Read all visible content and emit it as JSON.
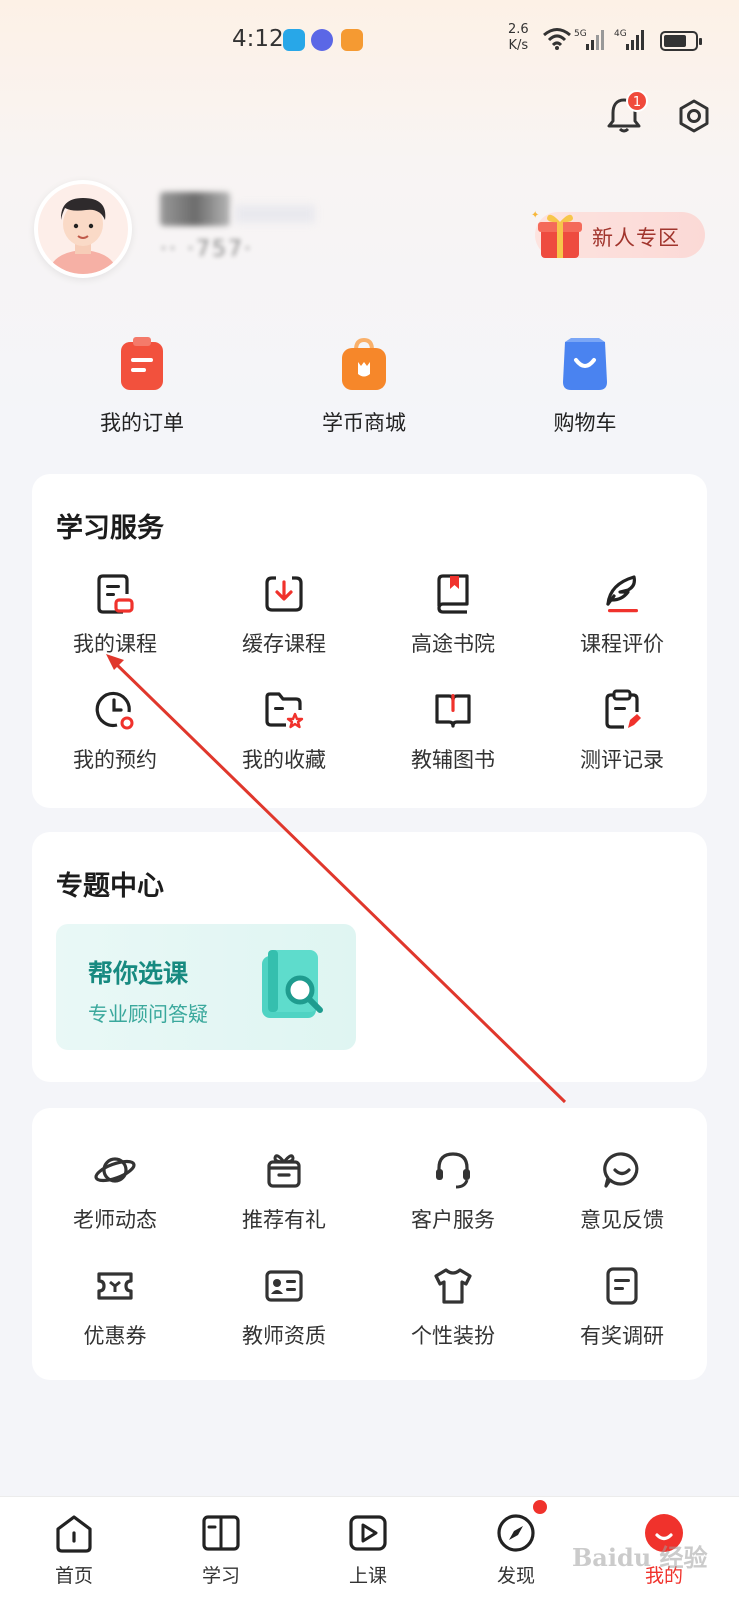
{
  "status_bar": {
    "time": "4:12",
    "network_speed_value": "2.6",
    "network_speed_unit": "K/s",
    "signal_1_label": "5G",
    "signal_2_label": "4G"
  },
  "header": {
    "notification_count": "1"
  },
  "profile": {
    "name": "",
    "id_masked": "··    ·757·",
    "newbie_label": "新人专区"
  },
  "quick_actions": [
    {
      "label": "我的订单",
      "icon": "clipboard-icon",
      "color": "#f2513d"
    },
    {
      "label": "学币商城",
      "icon": "shopping-bag-icon",
      "color": "#f6872a"
    },
    {
      "label": "购物车",
      "icon": "cart-icon",
      "color": "#4a83f0"
    }
  ],
  "learning_services": {
    "title": "学习服务",
    "items": [
      {
        "label": "我的课程",
        "icon": "course-doc-icon"
      },
      {
        "label": "缓存课程",
        "icon": "download-icon"
      },
      {
        "label": "高途书院",
        "icon": "book-bookmark-icon"
      },
      {
        "label": "课程评价",
        "icon": "feather-pen-icon"
      },
      {
        "label": "我的预约",
        "icon": "clock-icon"
      },
      {
        "label": "我的收藏",
        "icon": "folder-star-icon"
      },
      {
        "label": "教辅图书",
        "icon": "open-book-icon"
      },
      {
        "label": "测评记录",
        "icon": "clipboard-edit-icon"
      }
    ]
  },
  "topics": {
    "title": "专题中心",
    "promo_title": "帮你选课",
    "promo_subtitle": "专业顾问答疑"
  },
  "more_services": {
    "items": [
      {
        "label": "老师动态",
        "icon": "planet-icon"
      },
      {
        "label": "推荐有礼",
        "icon": "gift-box-icon"
      },
      {
        "label": "客户服务",
        "icon": "headset-icon"
      },
      {
        "label": "意见反馈",
        "icon": "chat-smile-icon"
      },
      {
        "label": "优惠券",
        "icon": "ticket-icon"
      },
      {
        "label": "教师资质",
        "icon": "id-card-icon"
      },
      {
        "label": "个性装扮",
        "icon": "tshirt-icon"
      },
      {
        "label": "有奖调研",
        "icon": "survey-icon"
      }
    ]
  },
  "bottom_nav": [
    {
      "label": "首页",
      "icon": "home-icon"
    },
    {
      "label": "学习",
      "icon": "book-icon"
    },
    {
      "label": "上课",
      "icon": "play-icon"
    },
    {
      "label": "发现",
      "icon": "compass-icon"
    },
    {
      "label": "我的",
      "icon": "profile-face-icon",
      "active": true
    }
  ],
  "accent_color": "#f0322c",
  "watermark": "Baidu 经验"
}
